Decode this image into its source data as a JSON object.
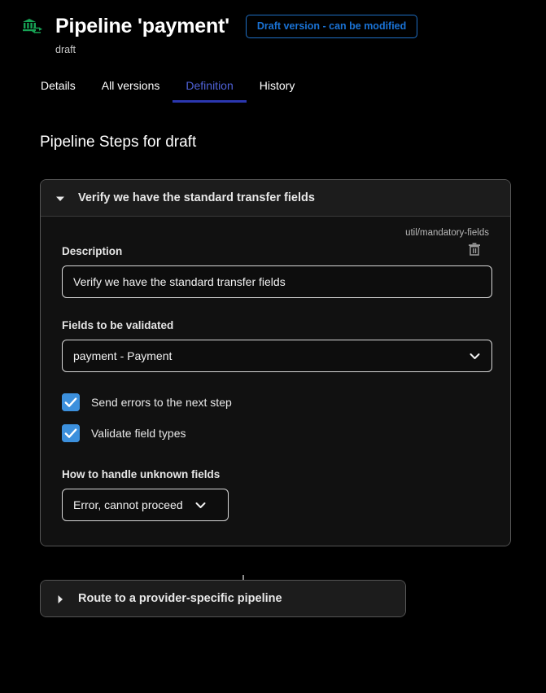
{
  "header": {
    "icon": "bank-transfer-icon",
    "title": "Pipeline 'payment'",
    "badge": "Draft version - can be modified",
    "subtitle": "draft",
    "badge_color": "#1a73d6"
  },
  "tabs": [
    {
      "label": "Details",
      "active": false
    },
    {
      "label": "All versions",
      "active": false
    },
    {
      "label": "Definition",
      "active": true
    },
    {
      "label": "History",
      "active": false
    }
  ],
  "main": {
    "section_title": "Pipeline Steps for draft"
  },
  "steps": [
    {
      "title": "Verify we have the standard transfer fields",
      "expanded": true,
      "caret": "caret-down-icon",
      "type_label": "util/mandatory-fields",
      "delete_icon": "trash-icon",
      "fields": {
        "description_label": "Description",
        "description_value": "Verify we have the standard transfer fields",
        "description_placeholder": "Description",
        "validated_label": "Fields to be validated",
        "validated_value": "payment - Payment",
        "unknown_label": "How to handle unknown fields",
        "unknown_value": "Error, cannot proceed"
      },
      "checkboxes": [
        {
          "label": "Send errors to the next step",
          "checked": true
        },
        {
          "label": "Validate field types",
          "checked": true
        }
      ]
    },
    {
      "title": "Route to a provider-specific pipeline",
      "expanded": false,
      "caret": "caret-right-icon"
    }
  ],
  "colors": {
    "accent_blue": "#3c90dd",
    "tab_active": "#4f62d8",
    "icon_green": "#17a355"
  }
}
